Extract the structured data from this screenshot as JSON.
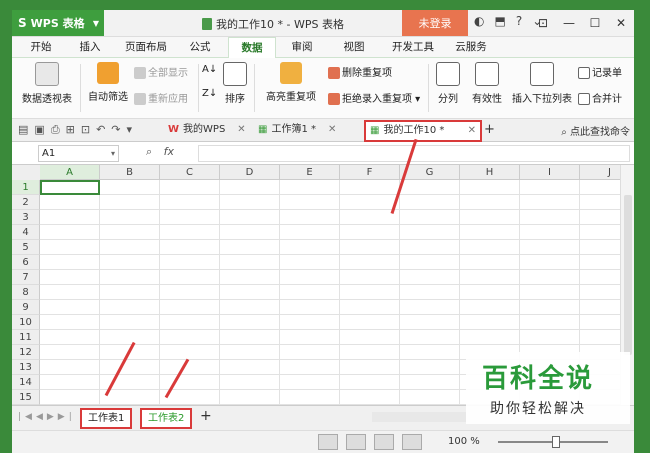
{
  "app": {
    "name": "WPS 表格",
    "doc_title": "我的工作10 * - WPS 表格",
    "login_label": "未登录"
  },
  "menu": {
    "tabs": [
      "开始",
      "插入",
      "页面布局",
      "公式",
      "数据",
      "审阅",
      "视图",
      "开发工具",
      "云服务"
    ],
    "active_index": 4
  },
  "ribbon": {
    "pivot": "数据透视表",
    "autofilter": "自动筛选",
    "show_all": "全部显示",
    "reapply": "重新应用",
    "sort": "排序",
    "highlight_dup": "高亮重复项",
    "delete_dup": "删除重复项",
    "reject_dup": "拒绝录入重复项",
    "split": "分列",
    "validity": "有效性",
    "dropdown_list": "插入下拉列表",
    "record_sheet": "记录单",
    "merge_calc": "合并计"
  },
  "doc_tabs": {
    "mywps": "我的WPS",
    "book1": "工作簿1 *",
    "active": "我的工作10 *",
    "search_cmd": "点此查找命令"
  },
  "formula_bar": {
    "cell_ref": "A1",
    "fx": "fx",
    "value": ""
  },
  "grid": {
    "columns": [
      "A",
      "B",
      "C",
      "D",
      "E",
      "F",
      "G",
      "H",
      "I",
      "J"
    ],
    "rows": [
      "1",
      "2",
      "3",
      "4",
      "5",
      "6",
      "7",
      "8",
      "9",
      "10",
      "11",
      "12",
      "13",
      "14",
      "15"
    ],
    "selected_cell": "A1"
  },
  "sheets": {
    "tabs": [
      "工作表1",
      "工作表2"
    ],
    "active": "工作表2"
  },
  "status": {
    "zoom": "100 %"
  },
  "watermark": {
    "line1": "百科全说",
    "line2": "助你轻松解决"
  },
  "colors": {
    "accent": "#3e9e3e",
    "login": "#e8744f",
    "highlight": "#d93a3a"
  }
}
